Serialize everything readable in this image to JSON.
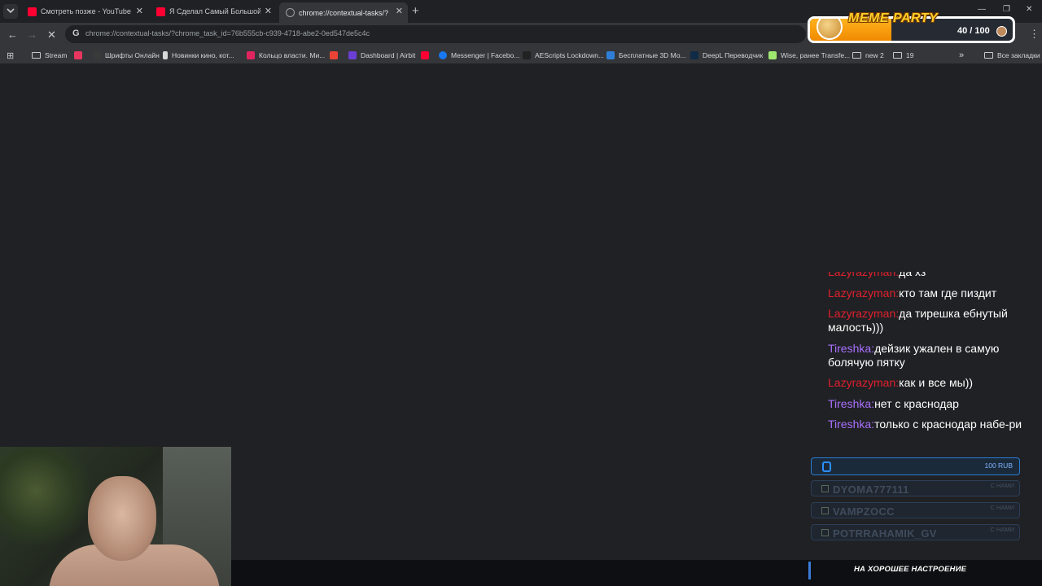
{
  "tabs": [
    {
      "title": "Смотреть позже - YouTube",
      "favicon_color": "#ff0033"
    },
    {
      "title": "Я Сделал Самый Большой Ле...",
      "favicon_color": "#ff0033"
    },
    {
      "title": "chrome://contextual-tasks/?ch",
      "favicon_color": "#9aa0a6"
    }
  ],
  "omnibox": {
    "url": "chrome://contextual-tasks/?chrome_task_id=76b555cb-c939-4718-abe2-0ed547de5c4c"
  },
  "bookmarks": [
    {
      "label": "Stream",
      "icon": "folder-icon",
      "color": "#c7c9cc"
    },
    {
      "label": "",
      "icon": "tool-icon",
      "color": "#e8365f"
    },
    {
      "label": "Шрифты Онлайн",
      "icon": "font-icon",
      "color": "#3a3a3a"
    },
    {
      "label": "Новинки кино, кот...",
      "icon": "film-icon",
      "color": "#d8d8d8"
    },
    {
      "label": "Кольцо власти. Ми...",
      "icon": "r-icon",
      "color": "#e0245e"
    },
    {
      "label": "",
      "icon": "gmail-icon",
      "color": "#ea4335"
    },
    {
      "label": "Dashboard | Airbit",
      "icon": "airbit-icon",
      "color": "#6b3fd6"
    },
    {
      "label": "",
      "icon": "youtube-icon",
      "color": "#ff0033"
    },
    {
      "label": "Messenger | Facebo...",
      "icon": "facebook-icon",
      "color": "#1877f2"
    },
    {
      "label": "AEScripts Lockdown...",
      "icon": "aescripts-icon",
      "color": "#222222"
    },
    {
      "label": "Бесплатные 3D Мо...",
      "icon": "3d-icon",
      "color": "#2f7fd8"
    },
    {
      "label": "DeepL Переводчик",
      "icon": "deepl-icon",
      "color": "#0f2b46"
    },
    {
      "label": "Wise, ранее Transfe...",
      "icon": "wise-icon",
      "color": "#9fe870"
    },
    {
      "label": "new 2",
      "icon": "folder-icon",
      "color": "#c7c9cc"
    },
    {
      "label": "19",
      "icon": "folder-icon",
      "color": "#c7c9cc"
    }
  ],
  "bookmarks_overflow": "»",
  "all_bookmarks": "Все закладки",
  "meme_party": {
    "title": "MEME PARTY",
    "count_label": "40 / 100",
    "progress": 0.4
  },
  "chat": [
    {
      "user": "Lazyrazyman:",
      "text": "да хз",
      "color": "#e0202e"
    },
    {
      "user": "Lazyrazyman:",
      "text": "кто там где пиздит",
      "color": "#e0202e"
    },
    {
      "user": "Lazyrazyman:",
      "text": "да тирешка ебнутый малость)))",
      "color": "#e0202e"
    },
    {
      "user": "Tireshka:",
      "text": "дейзик ужален в самую болячую пятку",
      "color": "#a970ff"
    },
    {
      "user": "Lazyrazyman:",
      "text": "как и все мы))",
      "color": "#e0202e"
    },
    {
      "user": "Tireshka:",
      "text": "нет с краснодар",
      "color": "#a970ff"
    },
    {
      "user": "Tireshka:",
      "text": "только с краснодар набе-ри",
      "color": "#a970ff"
    }
  ],
  "donation": {
    "amount": "100 RUB"
  },
  "subscribers": [
    {
      "name": "DYOMA777111",
      "tag": "С НАМИ"
    },
    {
      "name": "VAMPZOCC",
      "tag": "С НАМИ"
    },
    {
      "name": "POTRRAHAMIK_GV",
      "tag": "С НАМИ"
    }
  ],
  "bottom_banner": "НА ХОРОШЕЕ НАСТРОЕНИЕ"
}
